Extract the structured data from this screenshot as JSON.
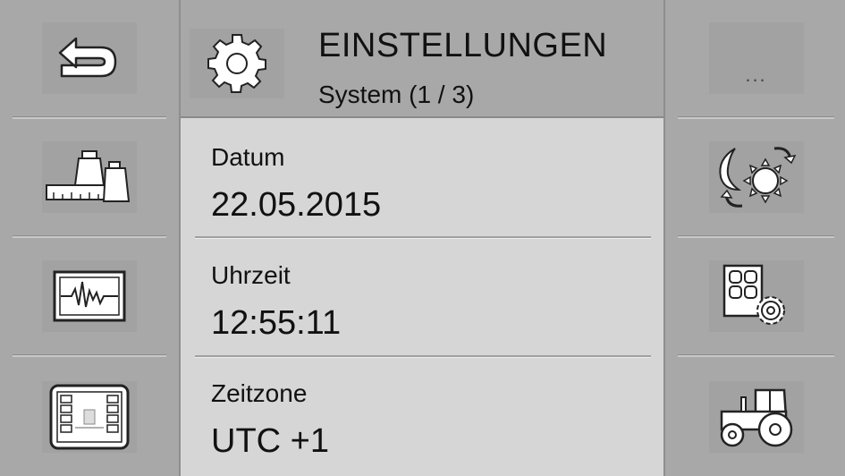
{
  "header": {
    "title": "EINSTELLUNGEN",
    "subtitle": "System (1 / 3)",
    "icon": "gear-icon"
  },
  "settings": [
    {
      "label": "Datum",
      "value": "22.05.2015"
    },
    {
      "label": "Uhrzeit",
      "value": "12:55:11"
    },
    {
      "label": "Zeitzone",
      "value": "UTC +1"
    }
  ],
  "left_buttons": [
    {
      "icon": "back-arrow-icon"
    },
    {
      "icon": "weights-icon"
    },
    {
      "icon": "waveform-monitor-icon"
    },
    {
      "icon": "terminal-screen-icon"
    }
  ],
  "right_buttons": [
    {
      "icon": "more-icon",
      "label": "..."
    },
    {
      "icon": "day-night-icon"
    },
    {
      "icon": "button-settings-icon"
    },
    {
      "icon": "tractor-icon"
    }
  ]
}
